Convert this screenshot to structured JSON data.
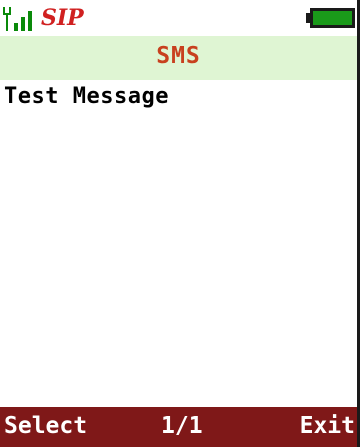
{
  "status": {
    "signal_icon": "signal-strength-icon",
    "sip_label": "SIP",
    "battery_icon": "battery-full-icon",
    "colors": {
      "signal": "#0a8a0a",
      "sip": "#d02020",
      "battery": "#1a9a1a"
    }
  },
  "title": "SMS",
  "messages": [
    {
      "text": "Test Message"
    }
  ],
  "softkeys": {
    "left": "Select",
    "center": "1/1",
    "right": "Exit"
  },
  "colors": {
    "title_bar_bg": "#dff5d3",
    "title_text": "#c8401e",
    "softkey_bar_bg": "#7f1818"
  }
}
